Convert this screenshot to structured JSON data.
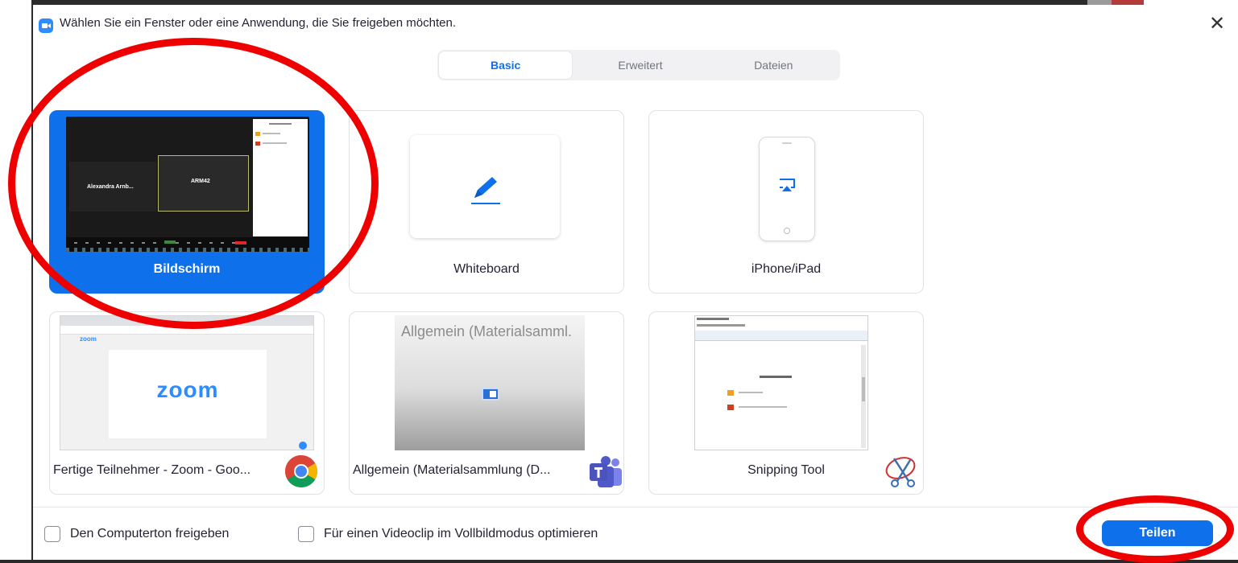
{
  "title": "Wählen Sie ein Fenster oder eine Anwendung, die Sie freigeben möchten.",
  "close_symbol": "✕",
  "tabs": [
    {
      "label": "Basic",
      "active": true
    },
    {
      "label": "Erweitert",
      "active": false
    },
    {
      "label": "Dateien",
      "active": false
    }
  ],
  "cards": {
    "screen": {
      "label": "Bildschirm",
      "selected": true,
      "thumb": {
        "tile1_name": "Alexandra Arnb...",
        "tile2_name": "ARM42"
      }
    },
    "whiteboard": {
      "label": "Whiteboard",
      "icon": "pen-icon"
    },
    "iphone": {
      "label": "iPhone/iPad",
      "icon": "airplay-icon"
    },
    "chrome": {
      "label": "Fertige Teilnehmer - Zoom - Goo...",
      "thumb_text": "zoom",
      "thumb_small": "zoom",
      "app_icon": "chrome-icon"
    },
    "teams": {
      "label": "Allgemein (Materialsammlung (D...",
      "thumb_text": "Allgemein (Materialsamml.",
      "app_icon": "teams-icon"
    },
    "snipping": {
      "label": "Snipping Tool",
      "app_icon": "scissors-icon"
    }
  },
  "footer": {
    "checkbox_sound": {
      "label": "Den Computerton freigeben",
      "checked": false
    },
    "checkbox_video": {
      "label": "Für einen Videoclip im Vollbildmodus optimieren",
      "checked": false
    },
    "share_label": "Teilen"
  },
  "colors": {
    "accent": "#0e71eb",
    "annotation": "#ee0000"
  }
}
